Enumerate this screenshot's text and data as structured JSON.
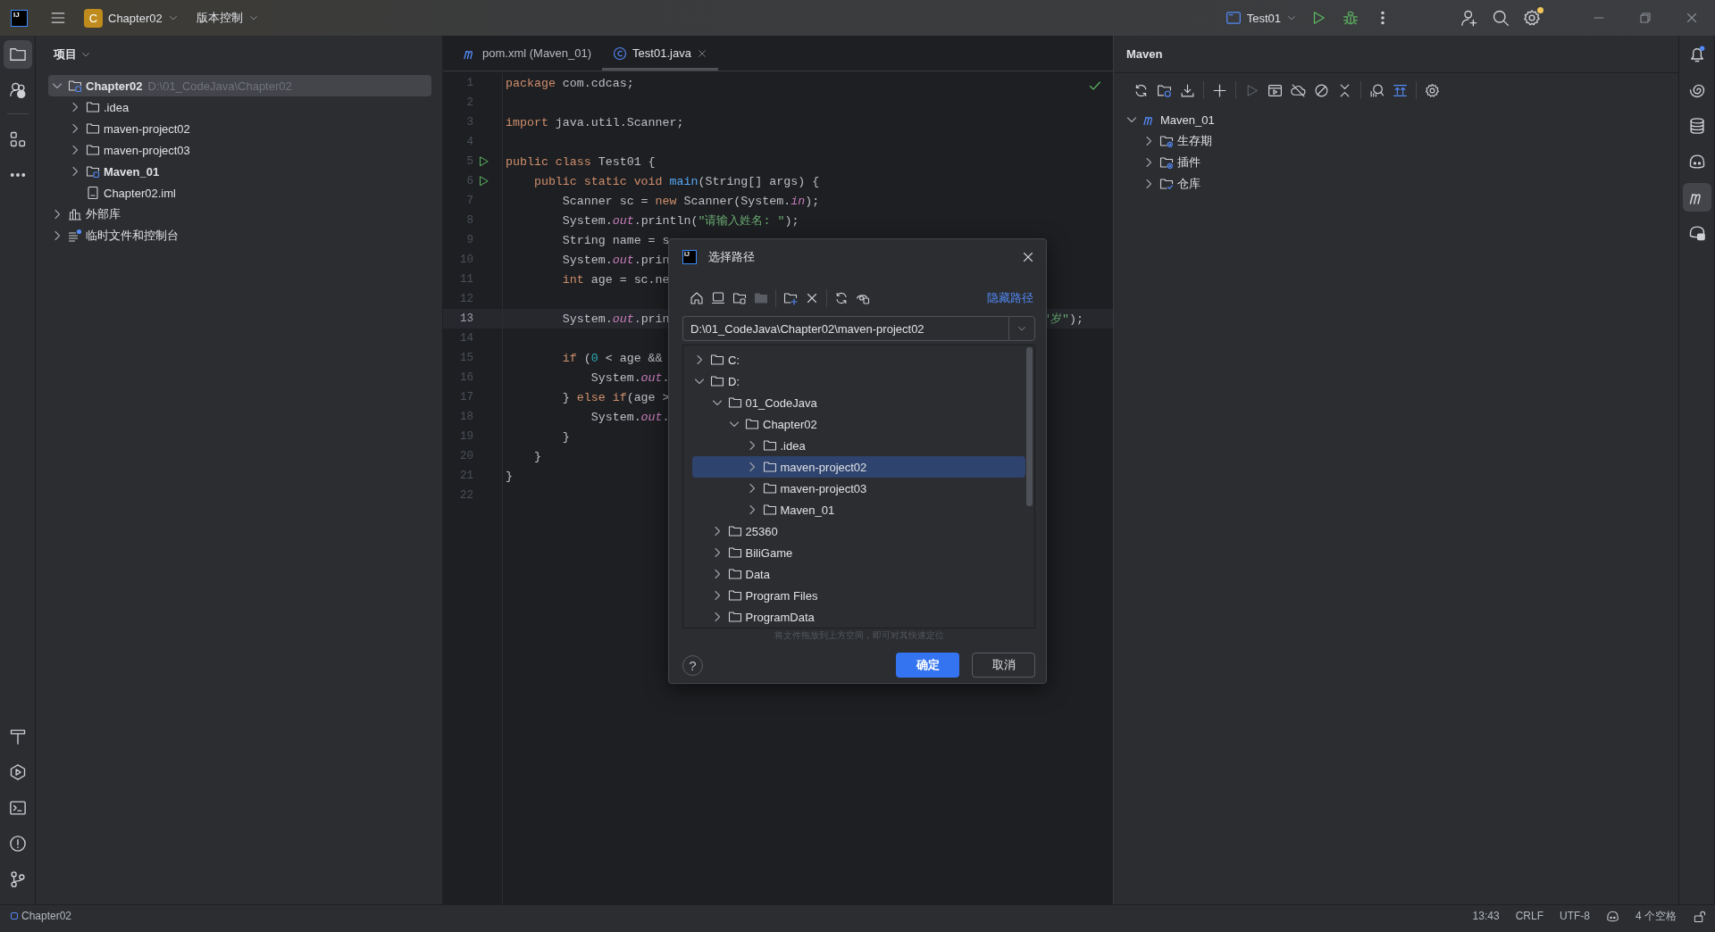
{
  "topbar": {
    "logo": "IJ",
    "project_badge": "C",
    "project": "Chapter02",
    "vcs": "版本控制",
    "run_config": "Test01"
  },
  "left_strip": {
    "top": [
      {
        "kind": "project",
        "selected": true
      },
      {
        "kind": "services",
        "selected": false
      },
      {
        "kind": "structure",
        "selected": false
      },
      {
        "kind": "more",
        "selected": false
      }
    ],
    "bottom": [
      {
        "kind": "build",
        "selected": false
      },
      {
        "kind": "run",
        "selected": false
      },
      {
        "kind": "terminal",
        "selected": false
      },
      {
        "kind": "problems",
        "selected": false
      },
      {
        "kind": "git",
        "selected": false
      }
    ]
  },
  "project_panel": {
    "title": "项目",
    "tree": [
      {
        "label": "Chapter02",
        "kind": "module",
        "hint": "D:\\01_CodeJava\\Chapter02",
        "expanded": true,
        "selected": true,
        "children": [
          {
            "label": ".idea",
            "kind": "folder",
            "expanded": false,
            "selected": false
          },
          {
            "label": "maven-project02",
            "kind": "folder",
            "expanded": false,
            "selected": false
          },
          {
            "label": "maven-project03",
            "kind": "folder",
            "expanded": false,
            "selected": false
          },
          {
            "label": "Maven_01",
            "kind": "module",
            "expanded": false,
            "selected": false
          },
          {
            "label": "Chapter02.iml",
            "kind": "file",
            "selected": false
          }
        ]
      },
      {
        "label": "外部库",
        "kind": "library",
        "expanded": false,
        "selected": false
      },
      {
        "label": "临时文件和控制台",
        "kind": "scratches",
        "expanded": false,
        "selected": false
      }
    ]
  },
  "editor": {
    "tabs": [
      {
        "label": "pom.xml (Maven_01)",
        "kind": "maven",
        "selected": false
      },
      {
        "label": "Test01.java",
        "kind": "class",
        "selected": true
      }
    ],
    "lines": [
      {
        "number": "1",
        "current": false,
        "run": false,
        "tokens": [
          {
            "kind": "keyword",
            "text": "package"
          },
          {
            "kind": "plain",
            "text": " com.cdcas;"
          }
        ]
      },
      {
        "number": "2",
        "current": false,
        "run": false
      },
      {
        "number": "3",
        "current": false,
        "run": false,
        "tokens": [
          {
            "kind": "keyword",
            "text": "import"
          },
          {
            "kind": "plain",
            "text": " java.util.Scanner;"
          }
        ]
      },
      {
        "number": "4",
        "current": false,
        "run": false
      },
      {
        "number": "5",
        "current": false,
        "run": true,
        "tokens": [
          {
            "kind": "keyword",
            "text": "public class"
          },
          {
            "kind": "plain",
            "text": " Test01 {"
          }
        ]
      },
      {
        "number": "6",
        "current": false,
        "run": true,
        "tokens": [
          {
            "kind": "keyword",
            "text": "    public static void"
          },
          {
            "kind": "method",
            "text": " main"
          },
          {
            "kind": "plain",
            "text": "(String[] args) {"
          }
        ]
      },
      {
        "number": "7",
        "current": false,
        "run": false,
        "tokens": [
          {
            "kind": "plain",
            "text": "        Scanner sc = "
          },
          {
            "kind": "keyword",
            "text": "new"
          },
          {
            "kind": "plain",
            "text": " Scanner(System."
          },
          {
            "kind": "field",
            "text": "in"
          },
          {
            "kind": "plain",
            "text": ");"
          }
        ]
      },
      {
        "number": "8",
        "current": false,
        "run": false,
        "tokens": [
          {
            "kind": "plain",
            "text": "        System."
          },
          {
            "kind": "field",
            "text": "out"
          },
          {
            "kind": "plain",
            "text": ".println("
          },
          {
            "kind": "string",
            "text": "\"请输入姓名: \""
          },
          {
            "kind": "plain",
            "text": ");"
          }
        ]
      },
      {
        "number": "9",
        "current": false,
        "run": false,
        "tokens": [
          {
            "kind": "plain",
            "text": "        String name = s"
          }
        ]
      },
      {
        "number": "10",
        "current": false,
        "run": false,
        "tokens": [
          {
            "kind": "plain",
            "text": "        System."
          },
          {
            "kind": "field",
            "text": "out"
          },
          {
            "kind": "plain",
            "text": ".prin"
          }
        ]
      },
      {
        "number": "11",
        "current": false,
        "run": false,
        "tokens": [
          {
            "kind": "keyword",
            "text": "        int"
          },
          {
            "kind": "plain",
            "text": " age = sc.ne"
          }
        ]
      },
      {
        "number": "12",
        "current": false,
        "run": false
      },
      {
        "number": "13",
        "current": true,
        "run": false,
        "tokens": [
          {
            "kind": "plain",
            "text": "        System."
          },
          {
            "kind": "field",
            "text": "out"
          },
          {
            "kind": "plain",
            "text": ".prin"
          }
        ],
        "tail": [
          {
            "kind": "string",
            "text": "\"岁\""
          },
          {
            "kind": "plain",
            "text": ");"
          }
        ]
      },
      {
        "number": "14",
        "current": false,
        "run": false
      },
      {
        "number": "15",
        "current": false,
        "run": false,
        "tokens": [
          {
            "kind": "keyword",
            "text": "        if"
          },
          {
            "kind": "plain",
            "text": " ("
          },
          {
            "kind": "number",
            "text": "0"
          },
          {
            "kind": "plain",
            "text": " < age &&"
          }
        ]
      },
      {
        "number": "16",
        "current": false,
        "run": false,
        "tokens": [
          {
            "kind": "plain",
            "text": "            System."
          },
          {
            "kind": "field",
            "text": "out"
          },
          {
            "kind": "plain",
            "text": "."
          }
        ]
      },
      {
        "number": "17",
        "current": false,
        "run": false,
        "tokens": [
          {
            "kind": "plain",
            "text": "        } "
          },
          {
            "kind": "keyword",
            "text": "else if"
          },
          {
            "kind": "plain",
            "text": "(age >"
          }
        ]
      },
      {
        "number": "18",
        "current": false,
        "run": false,
        "tokens": [
          {
            "kind": "plain",
            "text": "            System."
          },
          {
            "kind": "field",
            "text": "out"
          },
          {
            "kind": "plain",
            "text": "."
          }
        ]
      },
      {
        "number": "19",
        "current": false,
        "run": false,
        "tokens": [
          {
            "kind": "plain",
            "text": "        }"
          }
        ]
      },
      {
        "number": "20",
        "current": false,
        "run": false,
        "tokens": [
          {
            "kind": "plain",
            "text": "    }"
          }
        ]
      },
      {
        "number": "21",
        "current": false,
        "run": false,
        "tokens": [
          {
            "kind": "plain",
            "text": "}"
          }
        ]
      },
      {
        "number": "22",
        "current": false,
        "run": false
      }
    ]
  },
  "maven": {
    "title": "Maven",
    "tree": [
      {
        "label": "Maven_01",
        "kind": "project",
        "expanded": true,
        "selected": false,
        "children": [
          {
            "label": "生存期",
            "kind": "lifecycle",
            "expanded": false,
            "selected": false
          },
          {
            "label": "插件",
            "kind": "plugins",
            "expanded": false,
            "selected": false
          },
          {
            "label": "仓库",
            "kind": "repositories",
            "expanded": false,
            "selected": false
          }
        ]
      }
    ]
  },
  "right_strip": [
    {
      "kind": "notifications",
      "selected": false
    },
    {
      "kind": "spiral",
      "selected": false
    },
    {
      "kind": "database",
      "selected": false
    },
    {
      "kind": "copilot",
      "selected": false
    },
    {
      "kind": "maven",
      "selected": true
    },
    {
      "kind": "copilot-chat",
      "selected": false
    }
  ],
  "dialog": {
    "logo": "IJ",
    "title": "选择路径",
    "hide_path": "隐藏路径",
    "path": "D:\\01_CodeJava\\Chapter02\\maven-project02",
    "tree": [
      {
        "label": "C:",
        "expanded": false,
        "selected": false
      },
      {
        "label": "D:",
        "expanded": true,
        "selected": false,
        "children": [
          {
            "label": "01_CodeJava",
            "expanded": true,
            "selected": false,
            "children": [
              {
                "label": "Chapter02",
                "expanded": true,
                "selected": false,
                "children": [
                  {
                    "label": ".idea",
                    "expanded": false,
                    "selected": false
                  },
                  {
                    "label": "maven-project02",
                    "expanded": false,
                    "selected": true
                  },
                  {
                    "label": "maven-project03",
                    "expanded": false,
                    "selected": false
                  },
                  {
                    "label": "Maven_01",
                    "expanded": false,
                    "selected": false
                  }
                ]
              }
            ]
          },
          {
            "label": "25360",
            "expanded": false,
            "selected": false
          },
          {
            "label": "BiliGame",
            "expanded": false,
            "selected": false
          },
          {
            "label": "Data",
            "expanded": false,
            "selected": false
          },
          {
            "label": "Program Files",
            "expanded": false,
            "selected": false
          },
          {
            "label": "ProgramData",
            "expanded": false,
            "selected": false
          }
        ]
      }
    ],
    "hint": "将文件拖放到上方空间，即可对其快速定位",
    "help": "?",
    "ok": "确定",
    "cancel": "取消"
  },
  "status_bar": {
    "project": "Chapter02",
    "position": "13:43",
    "line_separator": "CRLF",
    "encoding": "UTF-8",
    "indent": "4 个空格"
  }
}
